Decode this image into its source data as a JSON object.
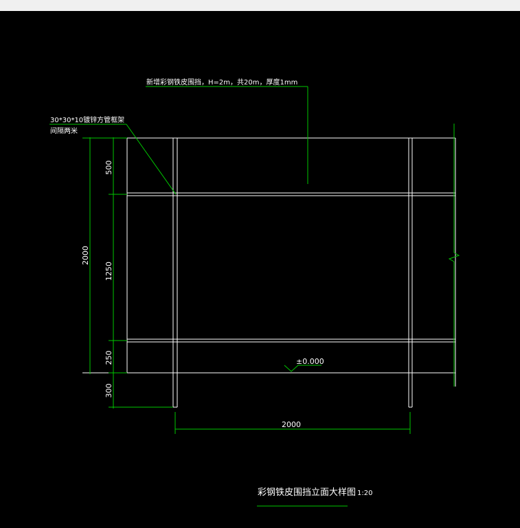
{
  "colors": {
    "background": "#000000",
    "frame_lines": "#ffffff",
    "dimension_lines": "#00c800",
    "top_bar": "#f0f0f0"
  },
  "annotations": {
    "panel_note": "新增彩钢铁皮围挡，H=2m，共20m，厚度1mm",
    "frame_note_line1": "30*30*10镀锌方管框架",
    "frame_note_line2": "间隔两米",
    "ground_level": "±0.000"
  },
  "dimensions": {
    "top_segment": "500",
    "middle_segment": "1250",
    "bottom_segment": "250",
    "total_height": "2000",
    "below_ground": "300",
    "post_spacing": "2000"
  },
  "title": {
    "text": "彩钢铁皮围挡立面大样图",
    "scale": "1:20"
  }
}
